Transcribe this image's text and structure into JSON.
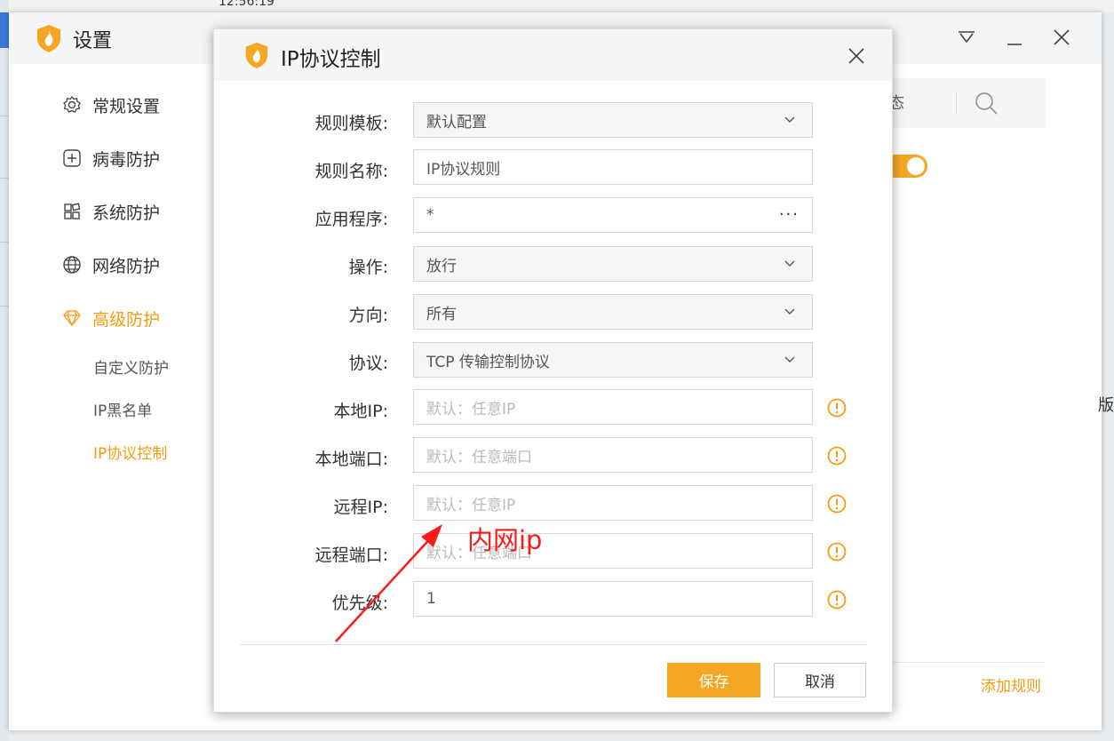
{
  "desktop": {
    "time": "12:56:19"
  },
  "main_window": {
    "title": "设置",
    "sidebar": {
      "items": [
        {
          "label": "常规设置",
          "icon": "gear-icon"
        },
        {
          "label": "病毒防护",
          "icon": "plus-square-icon"
        },
        {
          "label": "系统防护",
          "icon": "windows-icon"
        },
        {
          "label": "网络防护",
          "icon": "globe-icon"
        },
        {
          "label": "高级防护",
          "icon": "diamond-icon"
        }
      ],
      "sub_items": [
        "自定义防护",
        "IP黑名单",
        "IP协议控制"
      ]
    },
    "right_panel": {
      "status_partial": "态",
      "edge_text": "版",
      "add_rule": "添加规则"
    }
  },
  "dialog": {
    "title": "IP协议控制",
    "fields": {
      "template": {
        "label": "规则模板:",
        "value": "默认配置"
      },
      "name": {
        "label": "规则名称:",
        "value": "IP协议规则"
      },
      "app": {
        "label": "应用程序:",
        "value": "*"
      },
      "action": {
        "label": "操作:",
        "value": "放行"
      },
      "direction": {
        "label": "方向:",
        "value": "所有"
      },
      "protocol": {
        "label": "协议:",
        "value": "TCP 传输控制协议"
      },
      "local_ip": {
        "label": "本地IP:",
        "placeholder": "默认：任意IP"
      },
      "local_port": {
        "label": "本地端口:",
        "placeholder": "默认：任意端口"
      },
      "remote_ip": {
        "label": "远程IP:",
        "placeholder": "默认：任意IP"
      },
      "remote_port": {
        "label": "远程端口:",
        "placeholder": "默认：任意端口"
      },
      "priority": {
        "label": "优先级:",
        "value": "1"
      }
    },
    "buttons": {
      "save": "保存",
      "cancel": "取消"
    }
  },
  "annotation": {
    "text": "内网ip"
  },
  "colors": {
    "accent": "#f5a623",
    "annotation": "#ff1a1a"
  }
}
